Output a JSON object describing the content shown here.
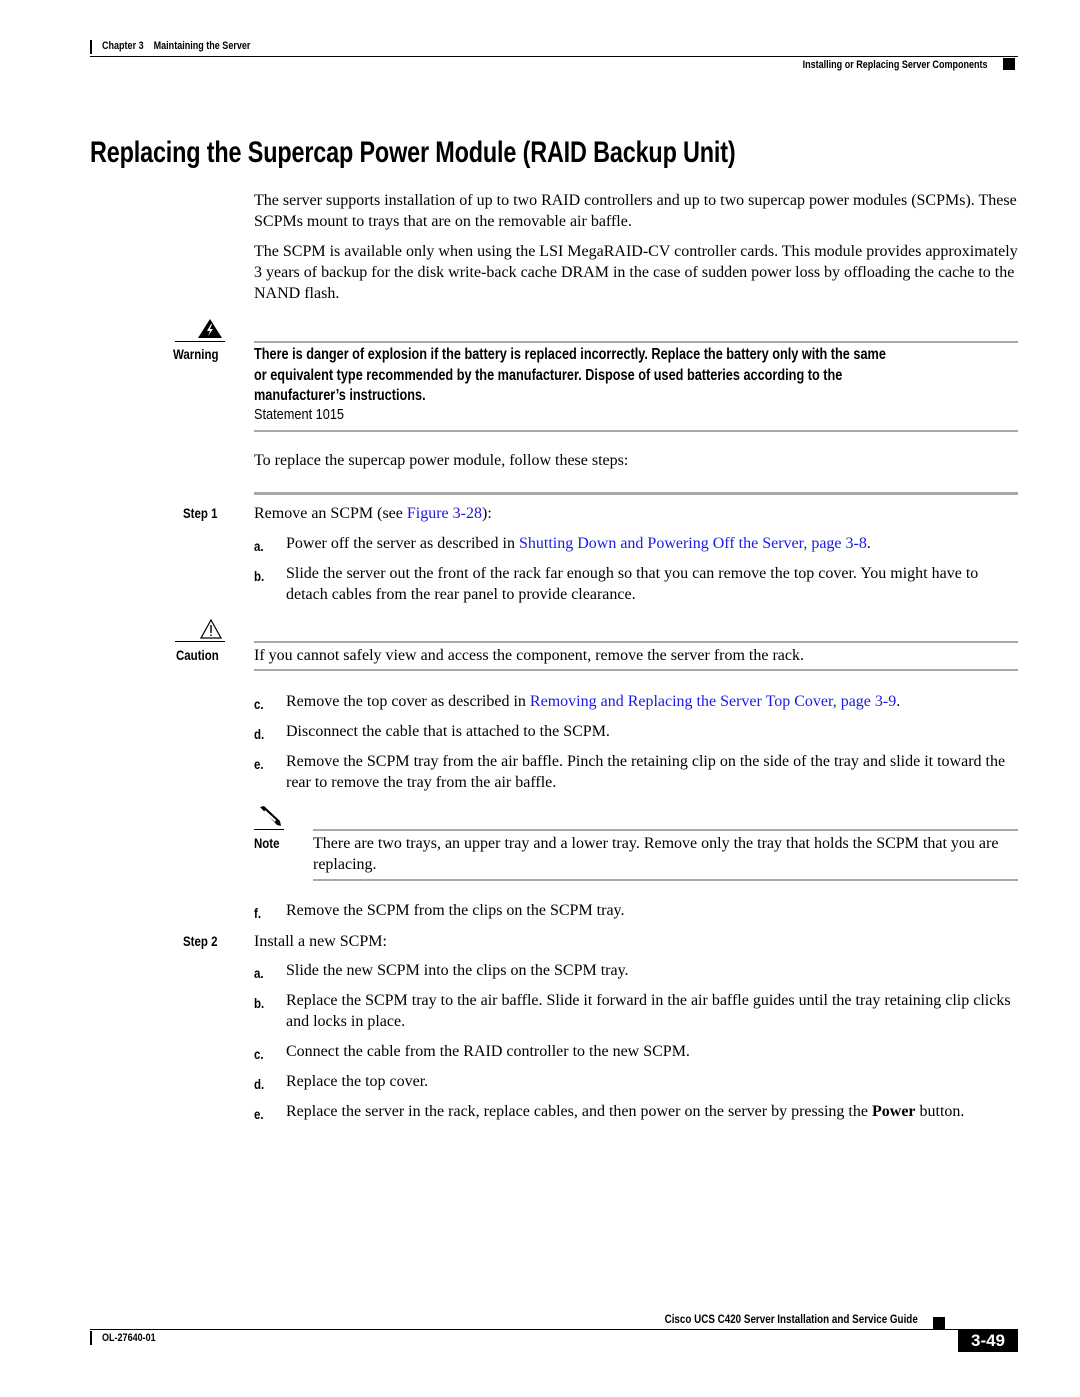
{
  "header": {
    "chapter": "Chapter 3",
    "chapter_title": "Maintaining the Server",
    "section": "Installing or Replacing Server Components"
  },
  "title": "Replacing the Supercap Power Module (RAID Backup Unit)",
  "intro": [
    "The server supports installation of up to two RAID controllers and up to two supercap power modules (SCPMs). These SCPMs mount to trays that are on the removable air baffle.",
    "The SCPM is available only when using the LSI MegaRAID-CV controller cards. This module provides approximately 3 years of backup for the disk write-back cache DRAM in the case of sudden power loss by offloading the cache to the NAND flash."
  ],
  "warning": {
    "label": "Warning",
    "icon": "warning-lightning-icon",
    "text": "There is danger of explosion if the battery is replaced incorrectly. Replace the battery only with the same or equivalent type recommended by the manufacturer. Dispose of used batteries according to the manufacturer’s instructions.",
    "statement": "Statement 1015"
  },
  "procedure_intro": "To replace the supercap power module, follow these steps:",
  "step1": {
    "label": "Step 1",
    "text_before": "Remove an SCPM (see ",
    "link": "Figure 3-28",
    "text_after": "):",
    "items": {
      "a": {
        "letter": "a.",
        "before": "Power off the server as described in ",
        "link": "Shutting Down and Powering Off the Server, page 3-8",
        "after": "."
      },
      "b": {
        "letter": "b.",
        "text": "Slide the server out the front of the rack far enough so that you can remove the top cover. You might have to detach cables from the rear panel to provide clearance."
      },
      "c": {
        "letter": "c.",
        "before": "Remove the top cover as described in ",
        "link": "Removing and Replacing the Server Top Cover, page 3-9",
        "after": "."
      },
      "d": {
        "letter": "d.",
        "text": "Disconnect the cable that is attached to the SCPM."
      },
      "e": {
        "letter": "e.",
        "text": "Remove the SCPM tray from the air baffle. Pinch the retaining clip on the side of the tray and slide it toward the rear to remove the tray from the air baffle."
      },
      "f": {
        "letter": "f.",
        "text": "Remove the SCPM from the clips on the SCPM tray."
      }
    }
  },
  "caution": {
    "label": "Caution",
    "icon": "caution-triangle-icon",
    "text": "If you cannot safely view and access the component, remove the server from the rack."
  },
  "note": {
    "label": "Note",
    "icon": "note-pencil-icon",
    "text": "There are two trays, an upper tray and a lower tray. Remove only the tray that holds the SCPM that you are replacing."
  },
  "step2": {
    "label": "Step 2",
    "text": "Install a new SCPM:",
    "items": {
      "a": {
        "letter": "a.",
        "text": "Slide the new SCPM into the clips on the SCPM tray."
      },
      "b": {
        "letter": "b.",
        "text": "Replace the SCPM tray to the air baffle. Slide it forward in the air baffle guides until the tray retaining clip clicks and locks in place."
      },
      "c": {
        "letter": "c.",
        "text": "Connect the cable from the RAID controller to the new SCPM."
      },
      "d": {
        "letter": "d.",
        "text": "Replace the top cover."
      },
      "e": {
        "letter": "e.",
        "before": "Replace the server in the rack, replace cables, and then power on the server by pressing the ",
        "bold": "Power",
        "after": " button."
      }
    }
  },
  "footer": {
    "guide_title": "Cisco UCS C420 Server Installation and Service Guide",
    "doc_number": "OL-27640-01",
    "page": "3-49"
  },
  "colors": {
    "link": "#1a1ae6",
    "rule_gray": "#a8a8a8"
  }
}
